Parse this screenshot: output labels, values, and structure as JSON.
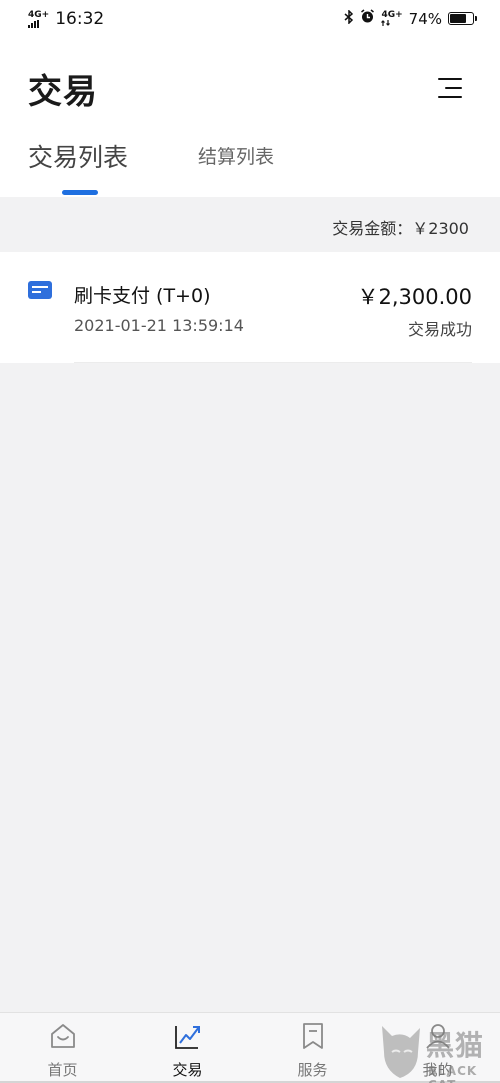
{
  "status_bar": {
    "network": "4G+",
    "time": "16:32",
    "network_right": "4G+",
    "battery_text": "74%",
    "battery_level": 0.74,
    "icons": [
      "bluetooth-icon",
      "alarm-icon",
      "signal-icon",
      "battery-icon"
    ]
  },
  "header": {
    "title": "交易",
    "menu_icon": "menu-icon"
  },
  "tabs": [
    {
      "label": "交易列表",
      "active": true
    },
    {
      "label": "结算列表",
      "active": false
    }
  ],
  "summary": {
    "text": "交易金额：￥2300"
  },
  "transactions": [
    {
      "icon": "card-icon",
      "title": "刷卡支付 (T+0)",
      "time": "2021-01-21 13:59:14",
      "amount": "￥2,300.00",
      "status": "交易成功"
    }
  ],
  "bottom_nav": [
    {
      "label": "首页",
      "icon": "home-icon",
      "active": false
    },
    {
      "label": "交易",
      "icon": "chart-trend-icon",
      "active": true
    },
    {
      "label": "服务",
      "icon": "bookmark-icon",
      "active": false
    },
    {
      "label": "我的",
      "icon": "user-icon",
      "active": false
    }
  ],
  "watermark": {
    "glyph": "黑猫",
    "text": "BLACK CAT"
  },
  "colors": {
    "accent": "#1e6fe0",
    "card_icon": "#2f6fdc",
    "background": "#f2f2f3"
  }
}
